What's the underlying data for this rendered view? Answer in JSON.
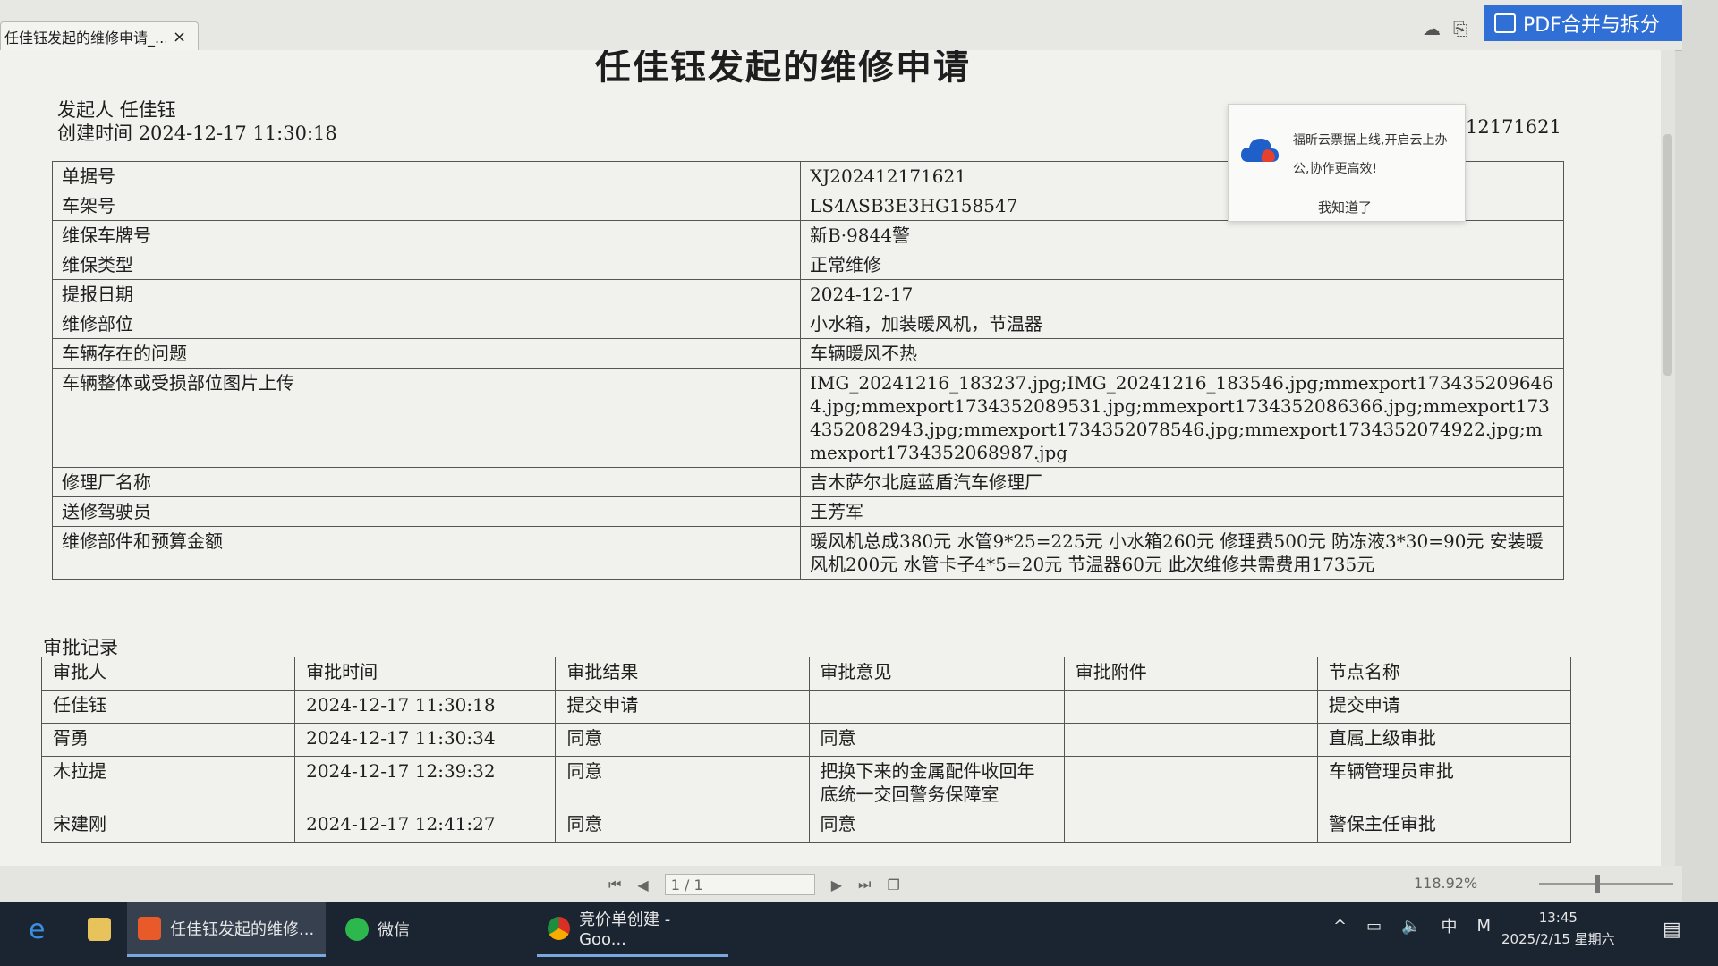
{
  "tab": {
    "title": "任佳钰发起的维修申请_...",
    "close": "×"
  },
  "toolbar": {
    "pdf_label": "PDF合并与拆分"
  },
  "doc": {
    "title": "任佳钰发起的维修申请",
    "initiator_label": "发起人",
    "initiator": "任佳钰",
    "created_label": "创建时间",
    "created": "2024-12-17 11:30:18",
    "order_tail": "12171621"
  },
  "info": [
    {
      "k": "单据号",
      "v": "XJ202412171621"
    },
    {
      "k": "车架号",
      "v": "LS4ASB3E3HG158547"
    },
    {
      "k": "维保车牌号",
      "v": "新B·9844警"
    },
    {
      "k": "维保类型",
      "v": "正常维修"
    },
    {
      "k": "提报日期",
      "v": "2024-12-17"
    },
    {
      "k": "维修部位",
      "v": "小水箱，加装暖风机，节温器"
    },
    {
      "k": "车辆存在的问题",
      "v": "车辆暖风不热"
    },
    {
      "k": "车辆整体或受损部位图片上传",
      "v": "IMG_20241216_183237.jpg;IMG_20241216_183546.jpg;mmexport1734352096464.jpg;mmexport1734352089531.jpg;mmexport1734352086366.jpg;mmexport1734352082943.jpg;mmexport1734352078546.jpg;mmexport1734352074922.jpg;mmexport1734352068987.jpg"
    },
    {
      "k": "修理厂名称",
      "v": "吉木萨尔北庭蓝盾汽车修理厂"
    },
    {
      "k": "送修驾驶员",
      "v": "王芳军"
    },
    {
      "k": "维修部件和预算金额",
      "v": "暖风机总成380元 水管9*25=225元 小水箱260元 修理费500元 防冻液3*30=90元 安装暖风机200元 水管卡子4*5=20元 节温器60元 此次维修共需费用1735元"
    }
  ],
  "approval": {
    "title": "审批记录",
    "headers": [
      "审批人",
      "审批时间",
      "审批结果",
      "审批意见",
      "审批附件",
      "节点名称"
    ],
    "rows": [
      [
        "任佳钰",
        "2024-12-17 11:30:18",
        "提交申请",
        "",
        "",
        "提交申请"
      ],
      [
        "胥勇",
        "2024-12-17 11:30:34",
        "同意",
        "同意",
        "",
        "直属上级审批"
      ],
      [
        "木拉提",
        "2024-12-17 12:39:32",
        "同意",
        "把换下来的金属配件收回年底统一交回警务保障室",
        "",
        "车辆管理员审批"
      ],
      [
        "宋建刚",
        "2024-12-17 12:41:27",
        "同意",
        "同意",
        "",
        "警保主任审批"
      ]
    ]
  },
  "popup": {
    "text": "福昕云票据上线,开启云上办公,协作更高效!",
    "button": "我知道了"
  },
  "bottombar": {
    "page": "1 / 1",
    "zoom": "118.92%"
  },
  "taskbar": {
    "items": [
      "任佳钰发起的维修...",
      "微信",
      "竞价单创建 - Goo..."
    ],
    "ime": "中",
    "ime_m": "M",
    "time": "13:45",
    "date": "2025/2/15 星期六"
  },
  "colors": {
    "accent": "#2f6fd6",
    "taskbar": "#1b2431"
  }
}
